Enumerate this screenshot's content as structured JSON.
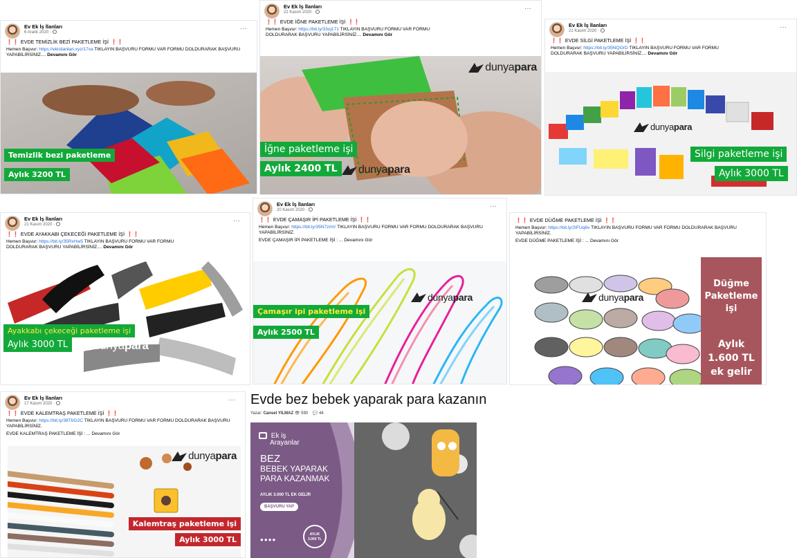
{
  "posts": [
    {
      "author": "Ev Ek İş İlanları",
      "date": "6 Aralık 2020 ·",
      "more": "···",
      "excl": "❗❗",
      "title": "EVDE TEMİZLİK BEZİ PAKETLEME İŞİ",
      "text_prefix": "Hemen Başvur: ",
      "link": "https://ekisilanlari.xyz/17va",
      "text_suffix": " TIKLAYIN BAŞVURU FORMU VAR FORMU DOLDURARAK BAŞVURU YAPABİLİRSİNİZ....",
      "see_more": "Devamını Gör",
      "label_top": "Temizlik bezi paketleme",
      "label_bottom": "Aylık 3200 TL"
    },
    {
      "author": "Ev Ek İş İlanları",
      "date": "22 Kasım 2020 ·",
      "more": "···",
      "excl": "❗❗",
      "title": "EVDE İĞNE PAKETLEME İŞİ",
      "text_prefix": "Hemen Başvur: ",
      "link": "https://bit.ly/33oj171",
      "text_suffix": " TIKLAYIN BAŞVURU FORMU VAR FORMU DOLDURARAK BAŞVURU YAPABİLİRSİNİZ....",
      "see_more": "Devamını Gör",
      "label_top": "İğne paketleme işi",
      "label_bottom": "Aylık 2400 TL",
      "brand_a": "dunya",
      "brand_b": "para"
    },
    {
      "author": "Ev Ek İş İlanları",
      "date": "21 Kasım 2020 ·",
      "more": "···",
      "excl": "❗❗",
      "title": "EVDE SİLGİ PAKETLEME İŞİ",
      "text_prefix": "Hemen Başvur: ",
      "link": "https://bit.ly/35NQOrD",
      "text_suffix": " TIKLAYIN BAŞVURU FORMU VAR FORMU DOLDURARAK BAŞVURU YAPABİLİRSİNİZ....",
      "see_more": "Devamını Gör",
      "label_top": "Silgi paketleme işi",
      "label_bottom": "Aylık 3000 TL",
      "brand_a": "dunya",
      "brand_b": "para"
    },
    {
      "author": "Ev Ek İş İlanları",
      "date": "21 Kasım 2020 ·",
      "more": "···",
      "excl": "❗❗",
      "title": "EVDE AYAKKABI ÇEKECEĞİ PAKETLEME İŞİ",
      "text_prefix": "Hemen Başvur: ",
      "link": "https://bit.ly/35RxHw5",
      "text_suffix": " TIKLAYIN BAŞVURU FORMU VAR FORMU DOLDURARAK BAŞVURU YAPABİLİRSİNİZ....",
      "see_more": "Devamını Gör",
      "label_top": "Ayakkabı çekeceği paketleme işi",
      "label_bottom": "Aylık 3000 TL",
      "brand_a": "dunya",
      "brand_b": "para"
    },
    {
      "author": "Ev Ek İş İlanları",
      "date": "20 Kasım 2020 ·",
      "more": "···",
      "excl": "❗❗",
      "title": "EVDE ÇAMAŞIR İPİ PAKETLEME İŞİ",
      "text_prefix": "Hemen Başvur: ",
      "link": "https://bit.ly/35N7zmV",
      "text_suffix": " TIKLAYIN BAŞVURU FORMU VAR FORMU DOLDURARAK BAŞVURU YAPABİLİRSİNİZ.",
      "text2": "EVDE ÇAMAŞIR İPİ PAKETLEME İŞİ : ...",
      "see_more": "Devamını Gör",
      "label_top": "Çamaşır ipi paketleme işi",
      "label_bottom": "Aylık 2500 TL",
      "brand_a": "dunya",
      "brand_b": "para"
    },
    {
      "excl": "❗❗",
      "title": "EVDE DÜĞME PAKETLEME İŞİ",
      "text_prefix": "Hemen Başvur: ",
      "link": "https://bit.ly/2IFUq6v",
      "text_suffix": " TIKLAYIN BAŞVURU FORMU VAR FORMU DOLDURARAK BAŞVURU YAPABİLİRSİNİZ.",
      "text2": "EVDE DÜĞME PAKETLEME İŞİ : ...",
      "see_more": "Devamını Gör",
      "side_title_1": "Düğme",
      "side_title_2": "Paketleme işi",
      "side_amount_1": "Aylık",
      "side_amount_2": "1.600 TL",
      "side_amount_3": "ek gelir",
      "brand_a": "dunya",
      "brand_b": "para"
    },
    {
      "author": "Ev Ek İş İlanları",
      "date": "17 Kasım 2020 ·",
      "more": "···",
      "excl": "❗❗",
      "title": "EVDE KALEMTRAŞ PAKETLEME İŞİ",
      "text_prefix": "Hemen Başvur: ",
      "link": "https://bit.ly/38TbG2C",
      "text_suffix": " TIKLAYIN BAŞVURU FORMU VAR FORMU DOLDURARAK BAŞVURU YAPABİLİRSİNİZ.",
      "text2": "EVDE KALEMTRAŞ PAKETLEME İŞİ : ...",
      "see_more": "Devamını Gör",
      "label_top": "Kalemtraş paketleme işi",
      "label_bottom": "Aylık 3000 TL",
      "brand_a": "dunya",
      "brand_b": "para"
    }
  ],
  "article": {
    "title": "Evde bez bebek yaparak para kazanın",
    "author_label": "Yazar:",
    "author": "Cansel YILMAZ",
    "views": "590",
    "comments": "44",
    "banner_logo_1": "Ek iş",
    "banner_logo_2": "Arayanlar",
    "banner_h1": "BEZ",
    "banner_h2": "BEBEK YAPARAK",
    "banner_h3": "PARA KAZANMAK",
    "banner_sub": "AYLIK 3.000 TL EK GELİR",
    "banner_button": "BAŞVURU YAP",
    "badge_1": "AYLIK",
    "badge_2": "3.000 TL"
  },
  "colors": {
    "green": "#12a93a",
    "red": "#c2272d",
    "link": "#216fdb",
    "excl": "#e02020"
  }
}
